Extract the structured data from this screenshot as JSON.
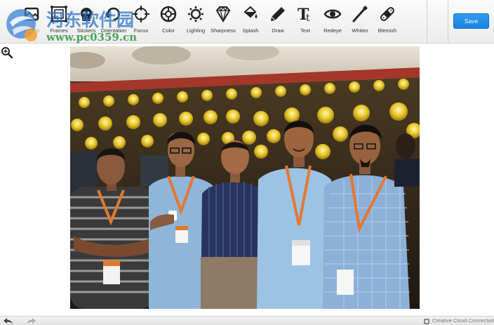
{
  "toolbar": {
    "tools": [
      {
        "label": "Effects",
        "icon": "effects-icon"
      },
      {
        "label": "Frames",
        "icon": "frames-icon"
      },
      {
        "label": "Stickers",
        "icon": "stickers-icon"
      },
      {
        "label": "Orientation",
        "icon": "orientation-icon"
      },
      {
        "label": "Focus",
        "icon": "focus-icon"
      },
      {
        "label": "Color",
        "icon": "color-icon"
      },
      {
        "label": "Lighting",
        "icon": "lighting-icon"
      },
      {
        "label": "Sharpness",
        "icon": "sharpness-icon"
      },
      {
        "label": "Splash",
        "icon": "splash-icon"
      },
      {
        "label": "Draw",
        "icon": "draw-icon"
      },
      {
        "label": "Text",
        "icon": "text-icon"
      },
      {
        "label": "Redeye",
        "icon": "redeye-icon"
      },
      {
        "label": "Whiten",
        "icon": "whiten-icon"
      },
      {
        "label": "Blemish",
        "icon": "blemish-icon"
      }
    ],
    "save_label": "Save"
  },
  "watermark": {
    "title": "河东软件园",
    "url": "www.pc0359.cn"
  },
  "footer": {
    "status": "Creative Cloud Connected"
  },
  "colors": {
    "accent": "#1a82df",
    "watermark_blue": "#3278c8",
    "watermark_green": "#28963c"
  }
}
